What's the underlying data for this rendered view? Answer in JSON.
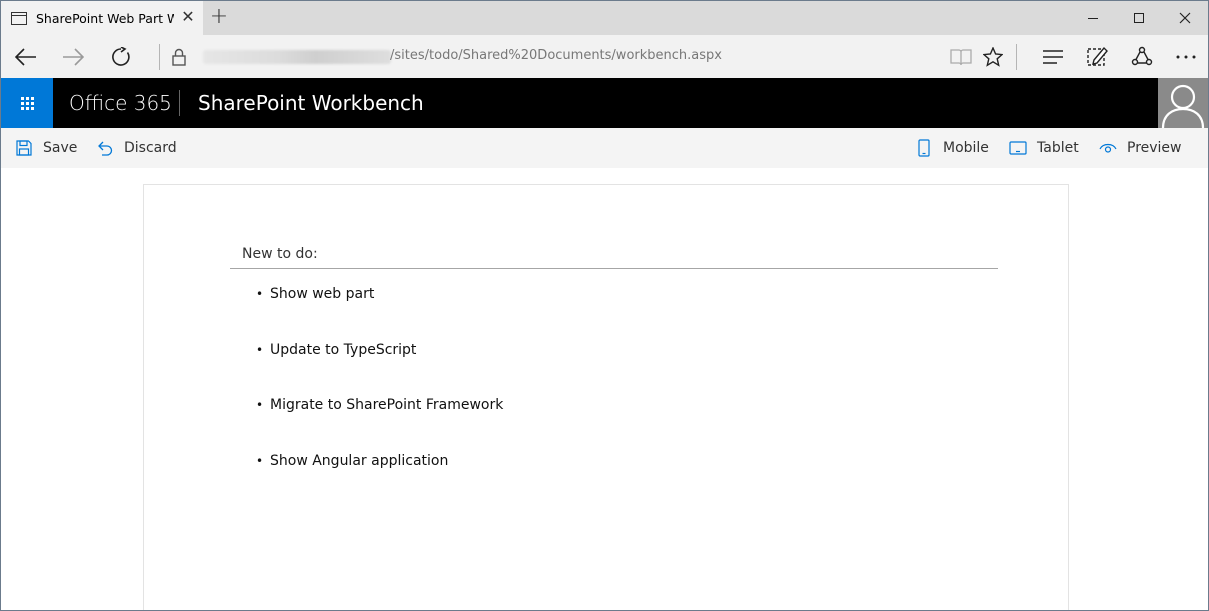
{
  "browser": {
    "tab_title": "SharePoint Web Part Wo",
    "tab_close": "✕",
    "new_tab": "+",
    "url_path": "/sites/todo/Shared%20Documents/workbench.aspx"
  },
  "suite": {
    "brand": "Office 365",
    "title": "SharePoint Workbench"
  },
  "commands": {
    "save": "Save",
    "discard": "Discard",
    "mobile": "Mobile",
    "tablet": "Tablet",
    "preview": "Preview"
  },
  "webpart": {
    "new_todo_label": "New to do:",
    "items": [
      "Show web part",
      "Update to TypeScript",
      "Migrate to SharePoint Framework",
      "Show Angular application"
    ]
  },
  "colors": {
    "accent": "#0078d7",
    "suitebar": "#000000",
    "commandbar": "#f4f4f4"
  }
}
